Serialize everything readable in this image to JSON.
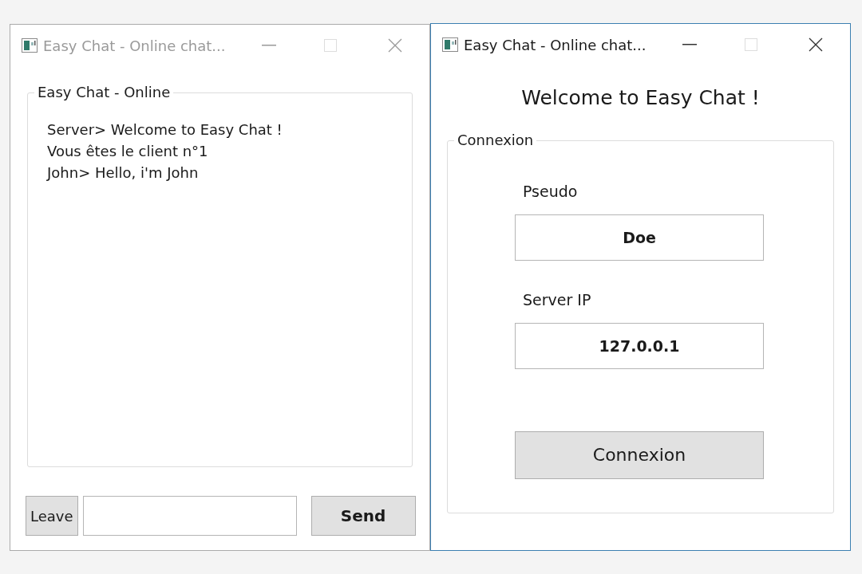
{
  "windows": [
    {
      "kind": "chat",
      "title": "Easy Chat - Online chat...",
      "active": false,
      "group": {
        "legend": "Easy Chat - Online",
        "messages": [
          "Server> Welcome to Easy Chat !",
          "Vous êtes le client n°1",
          "John> Hello, i'm John"
        ]
      },
      "leave_button": "Leave",
      "send_button": "Send"
    },
    {
      "kind": "login",
      "title": "Easy Chat - Online chat...",
      "active": true,
      "heading": "Welcome to Easy Chat !",
      "group": {
        "legend": "Connexion",
        "fields": [
          {
            "label": "Pseudo",
            "value": "Doe"
          },
          {
            "label": "Server IP",
            "value": "127.0.0.1"
          }
        ]
      },
      "connect_button": "Connexion"
    }
  ]
}
